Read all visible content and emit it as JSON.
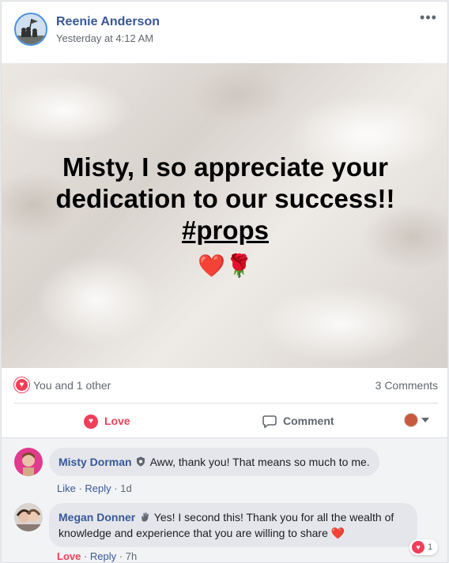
{
  "post": {
    "author": "Reenie Anderson",
    "timestamp": "Yesterday at 4:12 AM",
    "more_icon": "more-dots-icon",
    "banner": {
      "line1": "Misty, I so appreciate your",
      "line2": "dedication to our success!!",
      "hashtag": "#props",
      "emoji": "❤️🌹"
    }
  },
  "reactions": {
    "summary": "You and 1 other",
    "comment_count": "3 Comments"
  },
  "actions": {
    "love_label": "Love",
    "comment_label": "Comment"
  },
  "comments": [
    {
      "name": "Misty Dorman",
      "badge_icon": "shield-badge-icon",
      "text": "Aww, thank you! That means so much to me.",
      "like": "Like",
      "reply": "Reply",
      "time": "1d"
    },
    {
      "name": "Megan Donner",
      "badge_icon": "hand-badge-icon",
      "text_line1": "Yes! I second this! Thank you for all the wealth of",
      "text_line2": "knowledge and experience that you are willing to share",
      "text_emoji": "❤️",
      "like": "Love",
      "reply": "Reply",
      "time": "7h",
      "reaction_count": "1"
    }
  ],
  "colors": {
    "link_blue": "#385898",
    "love_red": "#f33e58",
    "meta_gray": "#606770",
    "comment_bg": "#f2f3f5"
  }
}
